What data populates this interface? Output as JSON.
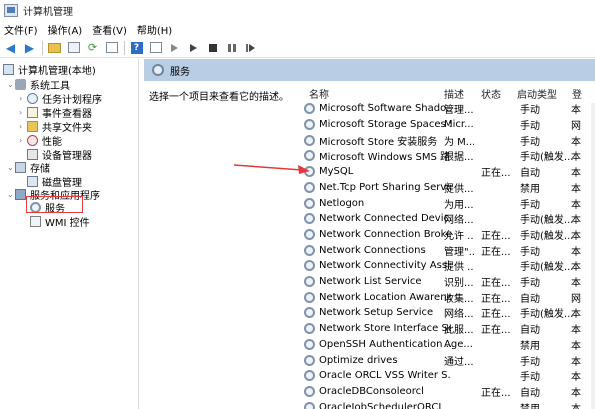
{
  "window": {
    "title": "计算机管理"
  },
  "menu": [
    "文件(F)",
    "操作(A)",
    "查看(V)",
    "帮助(H)"
  ],
  "tree": {
    "root": "计算机管理(本地)",
    "system_tools": "系统工具",
    "task_scheduler": "任务计划程序",
    "event_viewer": "事件查看器",
    "shared_folders": "共享文件夹",
    "performance": "性能",
    "device_manager": "设备管理器",
    "storage": "存储",
    "disk_management": "磁盘管理",
    "services_apps": "服务和应用程序",
    "services": "服务",
    "wmi": "WMI 控件"
  },
  "panel": {
    "title": "服务",
    "description": "选择一个项目来查看它的描述。",
    "columns": {
      "name": "名称",
      "desc": "描述",
      "status": "状态",
      "startup": "启动类型",
      "logon": "登"
    }
  },
  "services": [
    {
      "name": "Microsoft Software Shado...",
      "desc": "管理...",
      "status": "",
      "startup": "手动",
      "logon": "本"
    },
    {
      "name": "Microsoft Storage Spaces S...",
      "desc": "Micr...",
      "status": "",
      "startup": "手动",
      "logon": "网"
    },
    {
      "name": "Microsoft Store 安装服务",
      "desc": "为 M...",
      "status": "",
      "startup": "手动",
      "logon": "本"
    },
    {
      "name": "Microsoft Windows SMS 路...",
      "desc": "根据...",
      "status": "",
      "startup": "手动(触发...",
      "logon": "本"
    },
    {
      "name": "MySQL",
      "desc": "",
      "status": "正在...",
      "startup": "自动",
      "logon": "本"
    },
    {
      "name": "Net.Tcp Port Sharing Service",
      "desc": "提供...",
      "status": "",
      "startup": "禁用",
      "logon": "本"
    },
    {
      "name": "Netlogon",
      "desc": "为用...",
      "status": "",
      "startup": "手动",
      "logon": "本"
    },
    {
      "name": "Network Connected Devic...",
      "desc": "网络...",
      "status": "",
      "startup": "手动(触发...",
      "logon": "本"
    },
    {
      "name": "Network Connection Broker",
      "desc": "允许 ...",
      "status": "正在...",
      "startup": "手动(触发...",
      "logon": "本"
    },
    {
      "name": "Network Connections",
      "desc": "管理\"...",
      "status": "正在...",
      "startup": "手动",
      "logon": "本"
    },
    {
      "name": "Network Connectivity Assis...",
      "desc": "提供 ...",
      "status": "",
      "startup": "手动(触发...",
      "logon": "本"
    },
    {
      "name": "Network List Service",
      "desc": "识别...",
      "status": "正在...",
      "startup": "手动",
      "logon": "本"
    },
    {
      "name": "Network Location Awarene...",
      "desc": "收集...",
      "status": "正在...",
      "startup": "自动",
      "logon": "网"
    },
    {
      "name": "Network Setup Service",
      "desc": "网络...",
      "status": "正在...",
      "startup": "手动(触发...",
      "logon": "本"
    },
    {
      "name": "Network Store Interface Se...",
      "desc": "此服...",
      "status": "正在...",
      "startup": "自动",
      "logon": "本"
    },
    {
      "name": "OpenSSH Authentication ...",
      "desc": "Age...",
      "status": "",
      "startup": "禁用",
      "logon": "本"
    },
    {
      "name": "Optimize drives",
      "desc": "通过...",
      "status": "",
      "startup": "手动",
      "logon": "本"
    },
    {
      "name": "Oracle ORCL VSS Writer S...",
      "desc": "",
      "status": "",
      "startup": "手动",
      "logon": "本"
    },
    {
      "name": "OracleDBConsoleorcl",
      "desc": "",
      "status": "正在...",
      "startup": "自动",
      "logon": "本"
    },
    {
      "name": "OracleJobSchedulerORCL",
      "desc": "",
      "status": "",
      "startup": "禁用",
      "logon": "本"
    }
  ],
  "annotation_color": "#e23a3a"
}
